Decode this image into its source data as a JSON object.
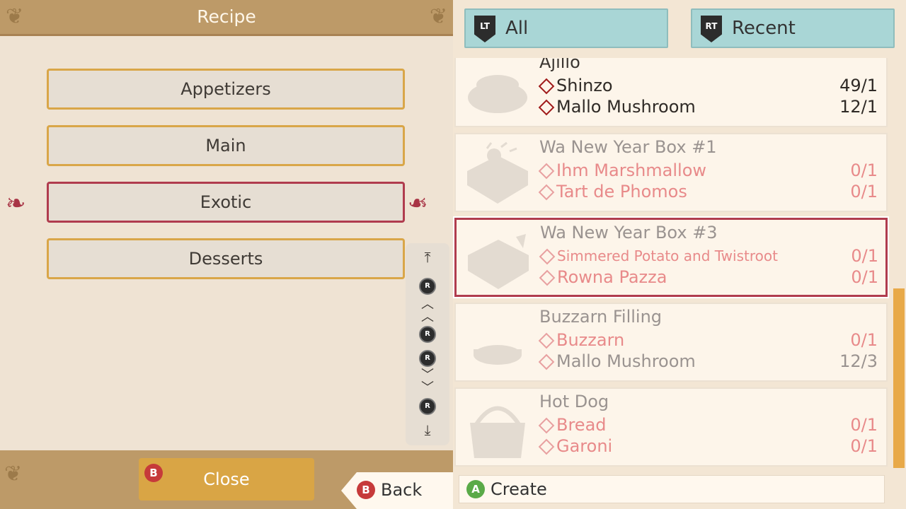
{
  "header": {
    "title": "Recipe"
  },
  "categories": [
    {
      "label": "Appetizers",
      "selected": false
    },
    {
      "label": "Main",
      "selected": false
    },
    {
      "label": "Exotic",
      "selected": true
    },
    {
      "label": "Desserts",
      "selected": false
    }
  ],
  "scroll_controls": {
    "r_label": "R"
  },
  "close_button": {
    "badge": "B",
    "label": "Close"
  },
  "back_button": {
    "badge": "B",
    "label": "Back"
  },
  "tabs": [
    {
      "icon": "LT",
      "label": "All"
    },
    {
      "icon": "RT",
      "label": "Recent"
    }
  ],
  "recipes": [
    {
      "name": "Ajillo",
      "thumb": "bowl-icon",
      "ingredients": [
        {
          "name": "Shinzo",
          "qty": "49/1"
        },
        {
          "name": "Mallo Mushroom",
          "qty": "12/1"
        }
      ]
    },
    {
      "name": "Wa New Year Box #1",
      "thumb": "bento-box-icon",
      "ingredients": [
        {
          "name": "Ihm Marshmallow",
          "qty": "0/1"
        },
        {
          "name": "Tart de Phomos",
          "qty": "0/1"
        }
      ]
    },
    {
      "name": "Wa New Year Box #3",
      "thumb": "bento-box-icon",
      "selected": true,
      "ingredients": [
        {
          "name": "Simmered Potato and Twistroot",
          "qty": "0/1"
        },
        {
          "name": "Rowna Pazza",
          "qty": "0/1"
        }
      ]
    },
    {
      "name": "Buzzarn Filling",
      "thumb": "dish-icon",
      "ingredients": [
        {
          "name": "Buzzarn",
          "qty": "0/1"
        },
        {
          "name": "Mallo Mushroom",
          "qty": "12/3"
        }
      ]
    },
    {
      "name": "Hot Dog",
      "thumb": "basket-icon",
      "ingredients": [
        {
          "name": "Bread",
          "qty": "0/1"
        },
        {
          "name": "Garoni",
          "qty": "0/1"
        }
      ]
    }
  ],
  "create_button": {
    "badge": "A",
    "label": "Create"
  },
  "colors": {
    "accent": "#b03c4e",
    "gold": "#d9a648",
    "tab": "#a9d6d6",
    "missing": "#e88a8a",
    "header": "#bd9a68"
  }
}
